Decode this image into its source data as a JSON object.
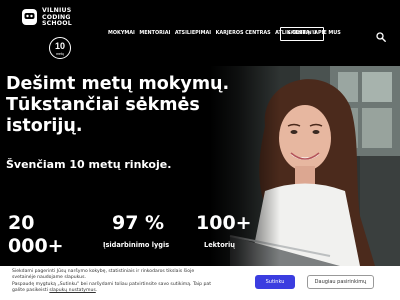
{
  "brand": {
    "line1": "VILNIUS",
    "line2": "CODING",
    "line3": "SCHOOL",
    "badge_number": "10",
    "badge_sub": "metų"
  },
  "nav": {
    "items": [
      "MOKYMAI",
      "MENTORIAI",
      "ATSILIEPIMAI",
      "KARJEROS CENTRAS",
      "ATLIK TESTĄ",
      "APIE MUS"
    ],
    "cta_label": "SKAMBINTI",
    "search_icon": "search-icon"
  },
  "hero": {
    "headline_line1": "Dešimt metų mokymų.",
    "headline_line2": "Tūkstančiai sėkmės",
    "headline_line3": "istorijų.",
    "subline": "Švenčiam 10 metų rinkoje."
  },
  "stats": [
    {
      "value_line1": "20",
      "value_line2": "000+",
      "label": ""
    },
    {
      "value_line1": "97 %",
      "value_line2": "",
      "label": "Įsidarbinimo lygis"
    },
    {
      "value_line1": "100+",
      "value_line2": "",
      "label": "Lektorių"
    }
  ],
  "cookie": {
    "line1": "Siekdami pagerinti Jūsų naršymo kokybę, statistiniais ir rinkodaros tikslais šioje",
    "line2": "svetainėje naudojame slapukus.",
    "line3": "Paspaudę mygtuką „Sutinku\" bei naršydami toliau patvirtinsite savo sutikimą. Taip pat",
    "line4_prefix": "galite pasikeisti ",
    "line4_link": "slapukų nustatymus",
    "line4_suffix": ".",
    "accept_label": "Sutinku",
    "more_label": "Daugiau pasirinkimų"
  },
  "colors": {
    "background": "#000000",
    "accent_button": "#3b3de0",
    "banner_bg": "#ffffff"
  }
}
